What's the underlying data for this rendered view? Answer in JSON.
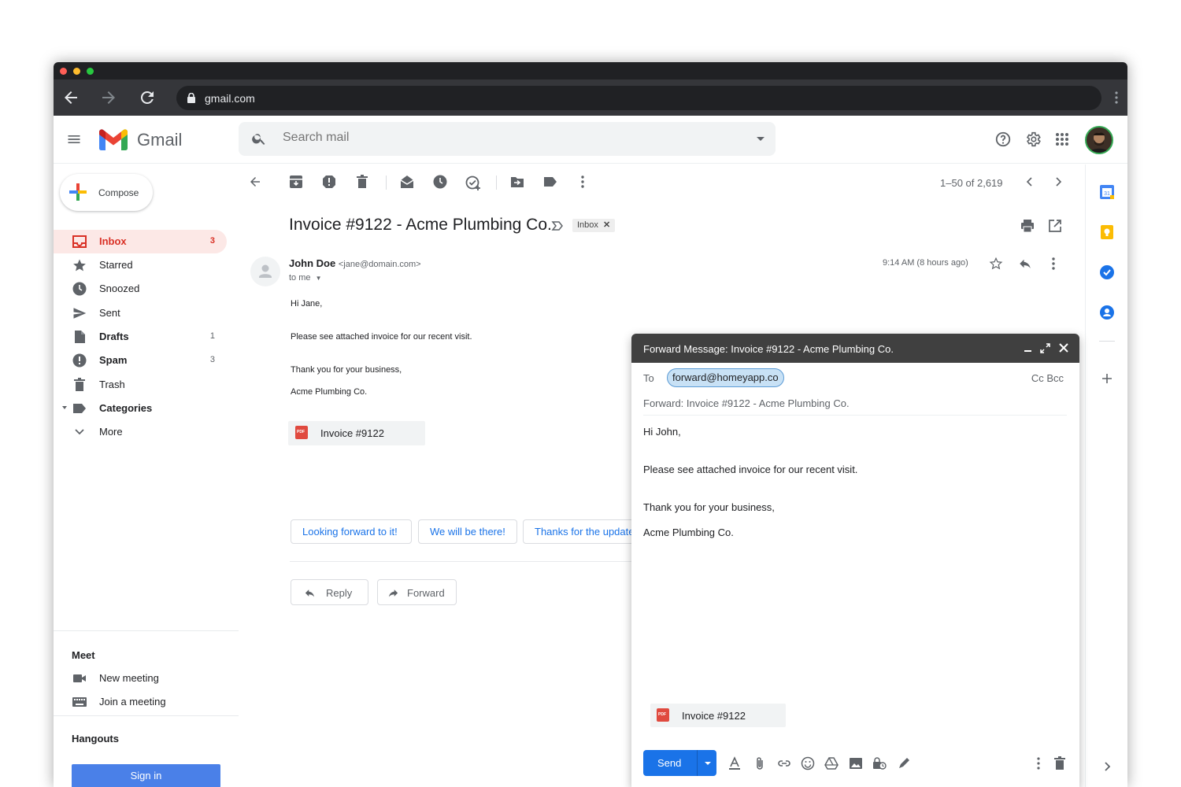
{
  "browser": {
    "url": "gmail.com"
  },
  "header": {
    "app_name": "Gmail",
    "search_placeholder": "Search mail",
    "icons": [
      "menu-icon",
      "search-icon",
      "help-icon",
      "gear-icon",
      "apps-icon",
      "avatar"
    ]
  },
  "sidebar": {
    "compose_label": "Compose",
    "items": [
      {
        "label": "Inbox",
        "count": "3",
        "icon": "inbox-icon",
        "active": true
      },
      {
        "label": "Starred",
        "count": "",
        "icon": "star-icon"
      },
      {
        "label": "Snoozed",
        "count": "",
        "icon": "clock-icon"
      },
      {
        "label": "Sent",
        "count": "",
        "icon": "send-icon"
      },
      {
        "label": "Drafts",
        "count": "1",
        "icon": "draft-icon"
      },
      {
        "label": "Spam",
        "count": "3",
        "icon": "spam-icon"
      },
      {
        "label": "Trash",
        "count": "",
        "icon": "trash-icon"
      },
      {
        "label": "Categories",
        "count": "",
        "icon": "label-icon"
      },
      {
        "label": "More",
        "count": "",
        "icon": "chevron-down-icon"
      }
    ],
    "meet": {
      "title": "Meet",
      "new_meeting": "New meeting",
      "join_meeting": "Join a meeting"
    },
    "hangouts": {
      "title": "Hangouts",
      "sign_in": "Sign in"
    }
  },
  "toolbar": {
    "pager": "1–50 of 2,619"
  },
  "message": {
    "subject": "Invoice #9122 - Acme Plumbing Co.",
    "tag": "Inbox",
    "sender_name": "John Doe",
    "sender_email": "<jane@domain.com>",
    "recipient_line": "to me",
    "time": "9:14 AM (8 hours ago)",
    "body": [
      "Hi Jane,",
      "Please see attached invoice for our recent visit.",
      "Thank you for your business,",
      "Acme Plumbing Co."
    ],
    "attachment": "Invoice #9122",
    "pdf_badge": "PDF",
    "smart_replies": [
      "Looking forward to it!",
      "We will be there!",
      "Thanks for the update!"
    ],
    "reply_label": "Reply",
    "forward_label": "Forward"
  },
  "forward_window": {
    "title": "Forward Message: Invoice #9122 - Acme Plumbing Co.",
    "to_label": "To",
    "recipient": "forward@homeyapp.co",
    "cc_bcc": "Cc Bcc",
    "subject": "Forward: Invoice #9122 - Acme Plumbing Co.",
    "body": [
      "Hi John,",
      "Please see attached invoice for our recent visit.",
      "Thank you for your business,",
      "Acme Plumbing Co."
    ],
    "attachment": "Invoice #9122",
    "send_label": "Send"
  },
  "colors": {
    "accent": "#1a73e8",
    "inbox_active": "#d93025",
    "dark_header": "#404040"
  }
}
